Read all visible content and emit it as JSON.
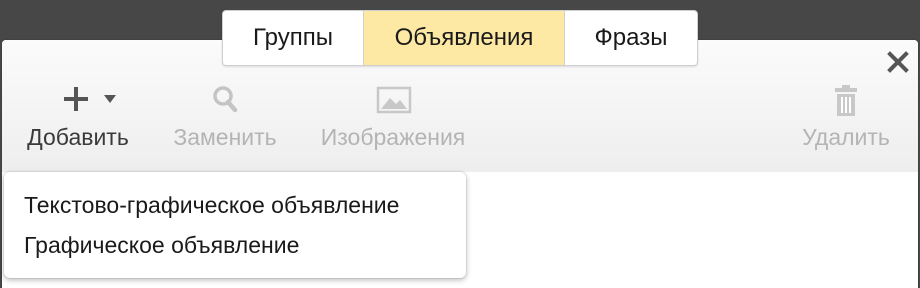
{
  "tabs": [
    {
      "label": "Группы",
      "active": false
    },
    {
      "label": "Объявления",
      "active": true
    },
    {
      "label": "Фразы",
      "active": false
    }
  ],
  "toolbar": {
    "add": {
      "label": "Добавить",
      "icon": "plus-icon",
      "enabled": true
    },
    "replace": {
      "label": "Заменить",
      "icon": "search-icon",
      "enabled": false
    },
    "images": {
      "label": "Изображения",
      "icon": "image-icon",
      "enabled": false
    },
    "delete": {
      "label": "Удалить",
      "icon": "trash-icon",
      "enabled": false
    }
  },
  "close_icon": "close-icon",
  "dropdown": {
    "items": [
      {
        "label": "Текстово-графическое объявление"
      },
      {
        "label": "Графическое объявление"
      }
    ]
  },
  "colors": {
    "active_tab": "#fde9a4",
    "background": "#474747",
    "disabled_text": "#b4b4b4",
    "enabled_text": "#3a3a3a"
  }
}
